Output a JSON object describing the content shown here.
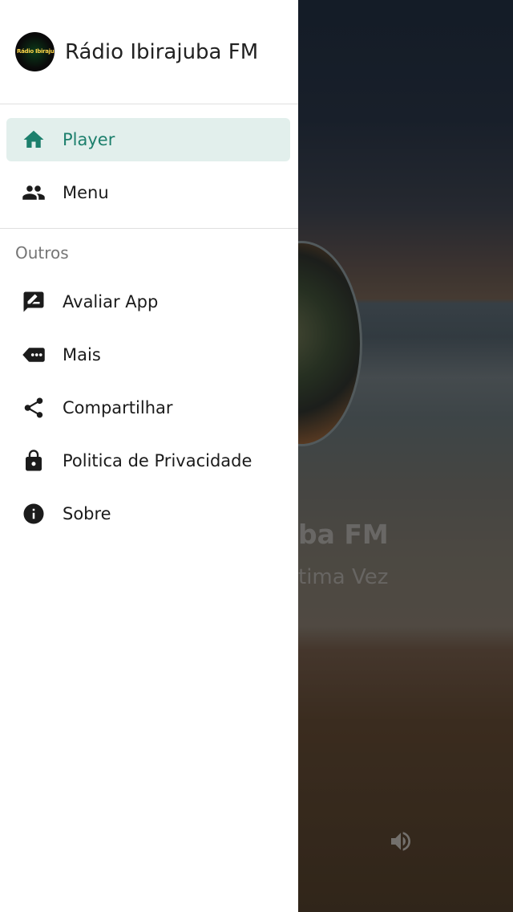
{
  "app": {
    "name": "Rádio Ibirajuba FM",
    "logo_text": "Rádio Ibirajuba"
  },
  "player_background": {
    "station_title_partial": "ba FM",
    "track_title_partial": "tima Vez",
    "volume_icon": "volume-icon"
  },
  "drawer": {
    "main_items": [
      {
        "label": "Player",
        "icon": "home-icon",
        "active": true
      },
      {
        "label": "Menu",
        "icon": "people-icon",
        "active": false
      }
    ],
    "others_header": "Outros",
    "other_items": [
      {
        "label": "Avaliar App",
        "icon": "rate-review-icon"
      },
      {
        "label": "Mais",
        "icon": "more-label-icon"
      },
      {
        "label": "Compartilhar",
        "icon": "share-icon"
      },
      {
        "label": "Politica de Privacidade",
        "icon": "lock-icon"
      },
      {
        "label": "Sobre",
        "icon": "info-icon"
      }
    ]
  },
  "colors": {
    "accent": "#1c7f6c",
    "active_bg": "#e2efec"
  }
}
